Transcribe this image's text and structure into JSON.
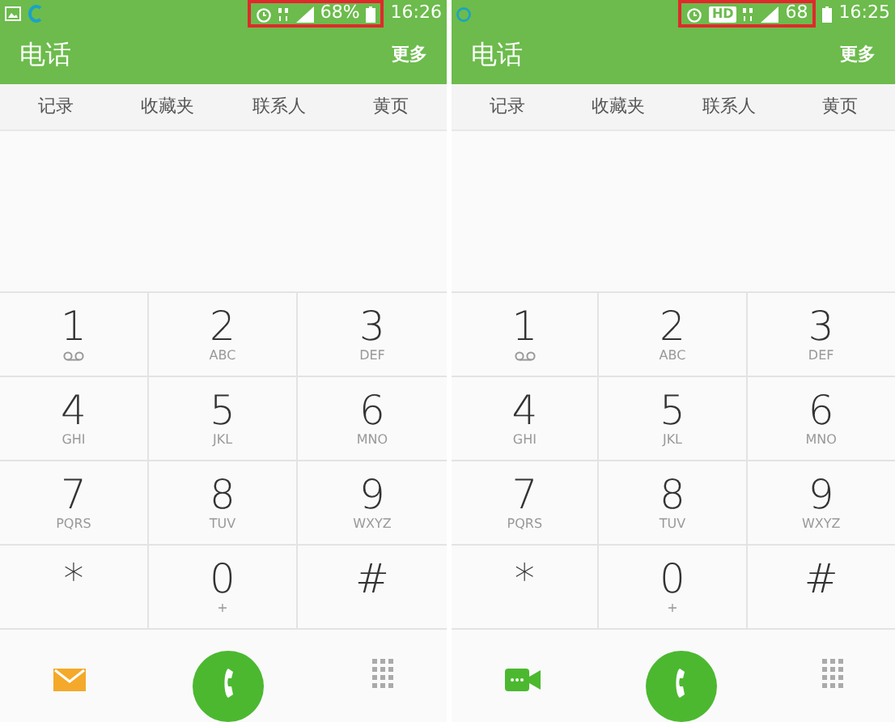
{
  "phones": [
    {
      "status_bar": {
        "left_icons": [
          {
            "kind": "gallery"
          },
          {
            "kind": "app"
          }
        ],
        "highlighted": [
          {
            "kind": "alarm"
          },
          {
            "kind": "lte"
          },
          {
            "kind": "signal"
          },
          {
            "kind": "text",
            "text": "68%"
          },
          {
            "kind": "battery"
          }
        ],
        "trailing": [
          {
            "kind": "text",
            "text": "16:26"
          }
        ]
      },
      "title": "电话",
      "menu": "更多",
      "tabs": [
        {
          "label": "记录"
        },
        {
          "label": "收藏夹"
        },
        {
          "label": "联系人"
        },
        {
          "label": "黄页"
        }
      ],
      "keys": [
        {
          "digit": "1",
          "kind": "voicemail"
        },
        {
          "digit": "2",
          "letters": "ABC"
        },
        {
          "digit": "3",
          "letters": "DEF"
        },
        {
          "digit": "4",
          "letters": "GHI"
        },
        {
          "digit": "5",
          "letters": "JKL"
        },
        {
          "digit": "6",
          "letters": "MNO"
        },
        {
          "digit": "7",
          "letters": "PQRS"
        },
        {
          "digit": "8",
          "letters": "TUV"
        },
        {
          "digit": "9",
          "letters": "WXYZ"
        },
        {
          "digit": "*"
        },
        {
          "digit": "0",
          "letters": "+"
        },
        {
          "digit": "#"
        }
      ],
      "bottom_left": {
        "kind": "message"
      }
    },
    {
      "status_bar": {
        "left_icons": [
          {
            "kind": "notification"
          }
        ],
        "highlighted": [
          {
            "kind": "alarm"
          },
          {
            "kind": "hd",
            "text": "HD"
          },
          {
            "kind": "lte"
          },
          {
            "kind": "signal"
          },
          {
            "kind": "text",
            "text": "68"
          }
        ],
        "trailing": [
          {
            "kind": "battery"
          },
          {
            "kind": "text",
            "text": "16:25"
          }
        ]
      },
      "title": "电话",
      "menu": "更多",
      "tabs": [
        {
          "label": "记录"
        },
        {
          "label": "收藏夹"
        },
        {
          "label": "联系人"
        },
        {
          "label": "黄页"
        }
      ],
      "keys": [
        {
          "digit": "1",
          "kind": "voicemail"
        },
        {
          "digit": "2",
          "letters": "ABC"
        },
        {
          "digit": "3",
          "letters": "DEF"
        },
        {
          "digit": "4",
          "letters": "GHI"
        },
        {
          "digit": "5",
          "letters": "JKL"
        },
        {
          "digit": "6",
          "letters": "MNO"
        },
        {
          "digit": "7",
          "letters": "PQRS"
        },
        {
          "digit": "8",
          "letters": "TUV"
        },
        {
          "digit": "9",
          "letters": "WXYZ"
        },
        {
          "digit": "*"
        },
        {
          "digit": "0",
          "letters": "+"
        },
        {
          "digit": "#"
        }
      ],
      "bottom_left": {
        "kind": "video"
      }
    }
  ]
}
